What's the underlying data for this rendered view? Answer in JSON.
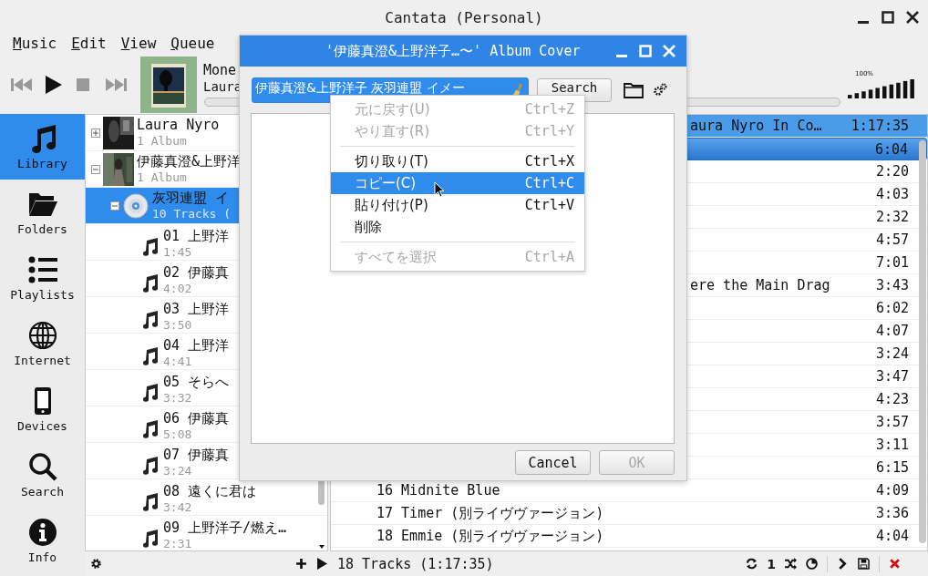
{
  "window": {
    "title": "Cantata (Personal)"
  },
  "menu": [
    "Music",
    "Edit",
    "View",
    "Queue"
  ],
  "now_playing": {
    "title": "Mone",
    "artist": "Laura",
    "progress": {
      "level": 0
    }
  },
  "volume": {
    "reading": "100%",
    "level": 1
  },
  "sidebar": [
    {
      "label": "Library",
      "kind": "music",
      "selected": true
    },
    {
      "label": "Folders",
      "kind": "folder",
      "selected": false
    },
    {
      "label": "Playlists",
      "kind": "list",
      "selected": false
    },
    {
      "label": "Internet",
      "kind": "globe",
      "selected": false
    },
    {
      "label": "Devices",
      "kind": "phone",
      "selected": false
    },
    {
      "label": "Search",
      "kind": "search",
      "selected": false
    },
    {
      "label": "Info",
      "kind": "info",
      "selected": false
    }
  ],
  "tree": [
    {
      "name": "Laura Nyro",
      "detail": "1 Album",
      "expanded": false,
      "selected": false
    },
    {
      "name": "伊藤真澄&上野洋",
      "detail": "1 Album",
      "expanded": true,
      "selected": false,
      "children": [
        {
          "name": "灰羽連盟 イ",
          "detail": "10 Tracks (",
          "expanded": true,
          "selected": true,
          "children": [
            {
              "name": "01 上野洋",
              "detail": "1:45",
              "selected": false
            },
            {
              "name": "02 伊藤真",
              "detail": "4:02",
              "selected": false
            },
            {
              "name": "03 上野洋",
              "detail": "3:50",
              "selected": false
            },
            {
              "name": "04 上野洋",
              "detail": "4:41",
              "selected": false
            },
            {
              "name": "05 そらへ",
              "detail": "3:32",
              "selected": false
            },
            {
              "name": "06 伊藤真",
              "detail": "5:08",
              "selected": false
            },
            {
              "name": "07 伊藤真",
              "detail": "3:24",
              "selected": false
            },
            {
              "name": "08 遠くに君は",
              "detail": "3:42",
              "selected": false
            },
            {
              "name": "09 上野洋子/燃え…",
              "detail": "2:31",
              "selected": false
            }
          ]
        }
      ]
    }
  ],
  "playlist": [
    {
      "kind": "album",
      "title": "aura Nyro In Co…",
      "cut": true,
      "duration": "1:17:35",
      "selected": true
    },
    {
      "kind": "track",
      "duration": "6:04",
      "selected": true
    },
    {
      "kind": "track",
      "duration": "2:20",
      "selected": false
    },
    {
      "kind": "track",
      "duration": "4:03",
      "selected": false
    },
    {
      "kind": "track",
      "duration": "2:32",
      "selected": false
    },
    {
      "kind": "track",
      "duration": "4:57",
      "selected": false
    },
    {
      "kind": "track",
      "duration": "7:01",
      "selected": false
    },
    {
      "kind": "track",
      "title": "ere the Main Drag",
      "cut": true,
      "duration": "3:43",
      "selected": false
    },
    {
      "kind": "track",
      "duration": "6:02",
      "selected": false
    },
    {
      "kind": "track",
      "duration": "4:07",
      "selected": false
    },
    {
      "kind": "track",
      "duration": "3:24",
      "selected": false
    },
    {
      "kind": "track",
      "duration": "3:47",
      "selected": false
    },
    {
      "kind": "track",
      "duration": "4:23",
      "selected": false
    },
    {
      "kind": "track",
      "duration": "3:57",
      "selected": false
    },
    {
      "kind": "track",
      "duration": "3:11",
      "selected": false
    },
    {
      "kind": "track",
      "duration": "6:15",
      "selected": false
    },
    {
      "kind": "track",
      "title": "16 Midnite Blue",
      "duration": "4:09",
      "selected": false
    },
    {
      "kind": "track",
      "title": "17 Timer (別ライヴヴァージョン)",
      "duration": "3:36",
      "selected": false
    },
    {
      "kind": "track",
      "title": "18 Emmie (別ライヴヴァージョン)",
      "duration": "4:04",
      "selected": false
    }
  ],
  "status_bar": {
    "summary": "18 Tracks (1:17:35)",
    "repeat_count": "1"
  },
  "dialog": {
    "title": "'伊藤真澄&上野洋子…〜' Album Cover",
    "search_value": "伊藤真澄&上野洋子 灰羽連盟 イメー",
    "search_button": "Search",
    "buttons": [
      {
        "label": "Cancel",
        "disabled": false
      },
      {
        "label": "OK",
        "disabled": true
      }
    ]
  },
  "context_menu": [
    {
      "kind": "item",
      "label": "元に戻す(U)",
      "shortcut": "Ctrl+Z",
      "disabled": true,
      "selected": false
    },
    {
      "kind": "item",
      "label": "やり直す(R)",
      "shortcut": "Ctrl+Y",
      "disabled": true,
      "selected": false
    },
    {
      "kind": "separator"
    },
    {
      "kind": "item",
      "label": "切り取り(T)",
      "shortcut": "Ctrl+X",
      "disabled": false,
      "selected": false
    },
    {
      "kind": "item",
      "label": "コピー(C)",
      "shortcut": "Ctrl+C",
      "disabled": false,
      "selected": true
    },
    {
      "kind": "item",
      "label": "貼り付け(P)",
      "shortcut": "Ctrl+V",
      "disabled": false,
      "selected": false
    },
    {
      "kind": "item",
      "label": "削除",
      "disabled": false,
      "selected": false
    },
    {
      "kind": "separator"
    },
    {
      "kind": "item",
      "label": "すべてを選択",
      "shortcut": "Ctrl+A",
      "disabled": true,
      "selected": false
    }
  ]
}
